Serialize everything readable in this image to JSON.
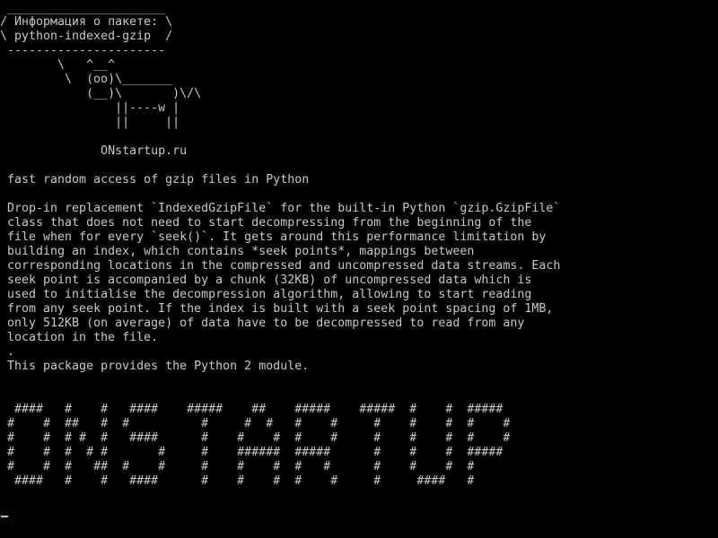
{
  "colors": {
    "background": "#000000",
    "foreground": "#c8c8c8"
  },
  "cowsay": {
    "bubble_top": " ______________________",
    "bubble_line1": "/ Информация о пакете: \\",
    "bubble_line2": "\\ python-indexed-gzip  /",
    "bubble_bottom": " ----------------------",
    "cow_line1": "        \\   ^__^",
    "cow_line2": "         \\  (oo)\\_______",
    "cow_line3": "            (__)\\       )\\/\\",
    "cow_line4": "                ||----w |",
    "cow_line5": "                ||     ||"
  },
  "site": "              ONstartup.ru",
  "package": {
    "summary": " fast random access of gzip files in Python",
    "description_lines": [
      " Drop-in replacement `IndexedGzipFile` for the built-in Python `gzip.GzipFile`",
      " class that does not need to start decompressing from the beginning of the",
      " file when for every `seek()`. It gets around this performance limitation by",
      " building an index, which contains *seek points*, mappings between",
      " corresponding locations in the compressed and uncompressed data streams. Each",
      " seek point is accompanied by a chunk (32KB) of uncompressed data which is",
      " used to initialise the decompression algorithm, allowing to start reading",
      " from any seek point. If the index is built with a seek point spacing of 1MB,",
      " only 512KB (on average) of data have to be decompressed to read from any",
      " location in the file.",
      " .",
      " This package provides the Python 2 module."
    ]
  },
  "banner_lines": [
    "  ####   #    #   ####    #####    ##    #####    #####  #    #  #####",
    " #    #  ##   #  #          #     #  #   #    #     #    #    #  #    #",
    " #    #  # #  #   ####      #    #    #  #    #     #    #    #  #    #",
    " #    #  #  # #       #     #    ######  #####      #    #    #  #####",
    " #    #  #   ##  #    #     #    #    #  #   #      #    #    #  #",
    "  ####   #    #   ####      #    #    #  #    #     #     ####   #"
  ]
}
